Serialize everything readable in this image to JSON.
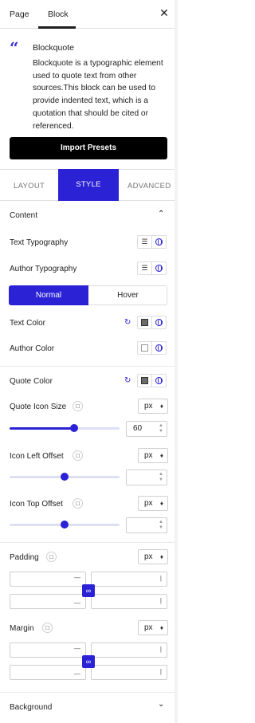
{
  "tabs": {
    "page": "Page",
    "block": "Block"
  },
  "close_glyph": "✕",
  "block": {
    "icon": "quote-icon",
    "title": "Blockquote",
    "description": "Blockquote is a typographic element used to quote text from other sources.This block can be used to provide indented text, which is a quotation that should be cited or referenced."
  },
  "import_button": "Import Presets",
  "settings_tabs": {
    "layout": "LAYOUT",
    "style": "STYLE",
    "advanced": "ADVANCED"
  },
  "content_section": {
    "title": "Content",
    "text_typography": "Text Typography",
    "author_typography": "Author Typography",
    "state_toggle": {
      "normal": "Normal",
      "hover": "Hover",
      "selected": "Normal"
    },
    "text_color": "Text Color",
    "author_color": "Author Color",
    "quote_color": "Quote Color",
    "quote_icon_size": {
      "label": "Quote Icon Size",
      "unit": "px",
      "value": "60",
      "percent": 0.62
    },
    "icon_left_offset": {
      "label": "Icon Left Offset",
      "unit": "px",
      "value": "",
      "percent": 0.5
    },
    "icon_top_offset": {
      "label": "Icon Top Offset",
      "unit": "px",
      "value": "",
      "percent": 0.5
    },
    "padding": {
      "label": "Padding",
      "unit": "px"
    },
    "margin": {
      "label": "Margin",
      "unit": "px"
    }
  },
  "background_section": {
    "title": "Background"
  },
  "colors": {
    "accent": "#2b22d6"
  }
}
